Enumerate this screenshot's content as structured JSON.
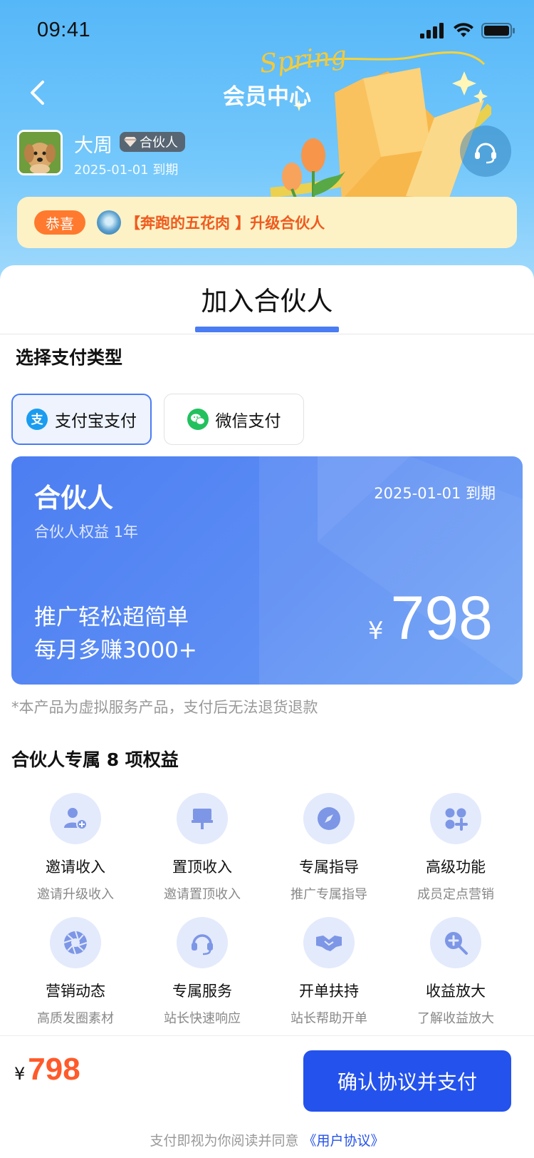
{
  "status_bar": {
    "time": "09:41"
  },
  "nav": {
    "title": "会员中心"
  },
  "header_art": {
    "word": "Spring"
  },
  "profile": {
    "name": "大周",
    "badge": "合伙人",
    "expire": "2025-01-01 到期"
  },
  "congrats": {
    "tag": "恭喜",
    "message": "【奔跑的五花肉 】升级合伙人"
  },
  "sheet": {
    "title": "加入合伙人"
  },
  "payment": {
    "label": "选择支付类型",
    "options": [
      {
        "label": "支付宝支付",
        "icon": "alipay-icon",
        "selected": true
      },
      {
        "label": "微信支付",
        "icon": "wechat-icon",
        "selected": false
      }
    ]
  },
  "plan": {
    "name": "合伙人",
    "subtitle": "合伙人权益  1年",
    "expire": "2025-01-01 到期",
    "slogan_line1": "推广轻松超简单",
    "slogan_line2": "每月多赚3000+",
    "currency": "¥",
    "price": "798"
  },
  "disclaimer": "*本产品为虚拟服务产品，支付后无法退货退款",
  "benefits": {
    "title": "合伙人专属 8 项权益",
    "items": [
      {
        "title": "邀请收入",
        "desc": "邀请升级收入",
        "icon": "add-user-icon"
      },
      {
        "title": "置顶收入",
        "desc": "邀请置顶收入",
        "icon": "pin-icon"
      },
      {
        "title": "专属指导",
        "desc": "推广专属指导",
        "icon": "compass-icon"
      },
      {
        "title": "高级功能",
        "desc": "成员定点营销",
        "icon": "apps-plus-icon"
      },
      {
        "title": "营销动态",
        "desc": "高质发圈素材",
        "icon": "aperture-icon"
      },
      {
        "title": "专属服务",
        "desc": "站长快速响应",
        "icon": "headset-icon"
      },
      {
        "title": "开单扶持",
        "desc": "站长帮助开单",
        "icon": "handshake-icon"
      },
      {
        "title": "收益放大",
        "desc": "了解收益放大",
        "icon": "zoom-in-icon"
      }
    ]
  },
  "bottom": {
    "currency": "¥",
    "price": "798",
    "button": "确认协议并支付",
    "agreement_prefix": "支付即视为你阅读并同意",
    "agreement_link": "《用户协议》"
  },
  "colors": {
    "accent": "#2452ec",
    "card": "#4c7ef2",
    "price": "#ff5a2a",
    "congrats": "#ef5a1e"
  }
}
